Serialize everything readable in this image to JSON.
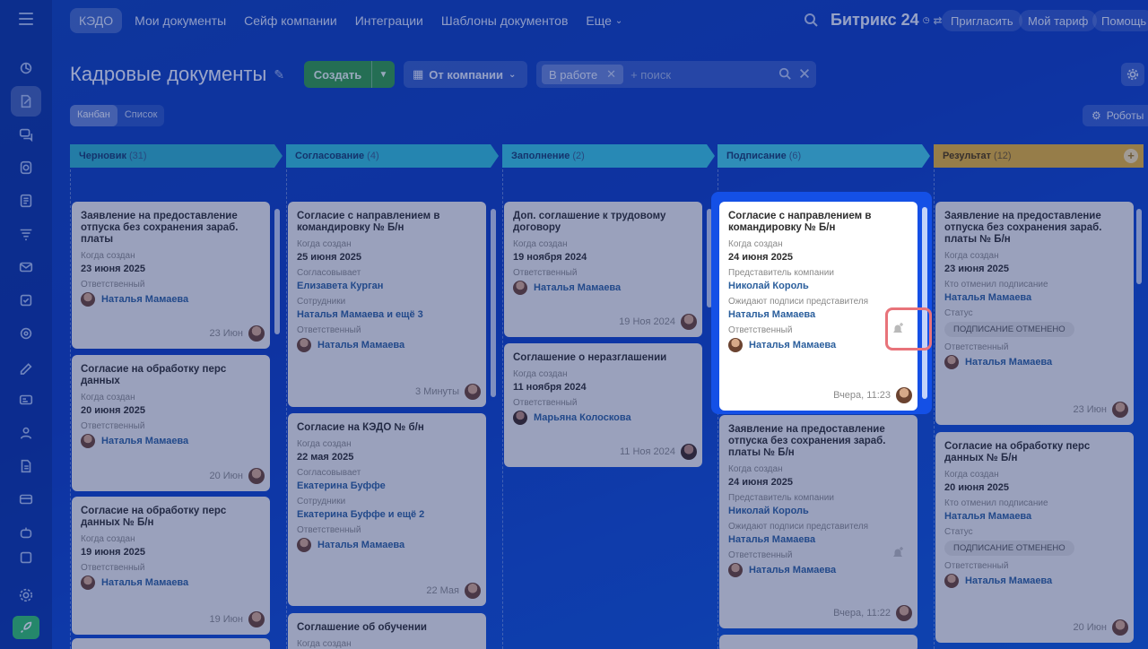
{
  "topnav": {
    "active_tab": "КЭДО",
    "items": [
      "Мои документы",
      "Сейф компании",
      "Интеграции",
      "Шаблоны документов"
    ],
    "more": "Еще",
    "brand": "Битрикс 24",
    "invite": "Пригласить",
    "tariff": "Мой тариф",
    "help": "Помощь"
  },
  "header": {
    "title": "Кадровые документы",
    "create": "Создать",
    "from_company": "От компании",
    "filter_chip": "В работе",
    "search_placeholder": "+ поиск"
  },
  "view": {
    "kanban": "Канбан",
    "list": "Список",
    "robots": "Роботы"
  },
  "columns": [
    {
      "title": "Черновик",
      "count": "(31)",
      "color": "#2cb0c8"
    },
    {
      "title": "Согласование",
      "count": "(4)",
      "color": "#2fbfd8"
    },
    {
      "title": "Заполнение",
      "count": "(2)",
      "color": "#35c6e0"
    },
    {
      "title": "Подписание",
      "count": "(6)",
      "color": "#3fcce6"
    },
    {
      "title": "Результат",
      "count": "(12)",
      "color": "#e6b233"
    }
  ],
  "labels": {
    "created": "Когда создан",
    "responsible": "Ответственный",
    "approver": "Согласовывает",
    "employees": "Сотрудники",
    "company_rep": "Представитель компании",
    "await_sign": "Ожидают подписи представителя",
    "cancelled_by": "Кто отменил подписание",
    "status": "Статус"
  },
  "cards": {
    "c1_1": {
      "title": "Заявление на предоставление отпуска без сохранения зараб. платы",
      "date": "23 июня 2025",
      "resp": "Наталья Мамаева",
      "foot": "23 Июн"
    },
    "c1_2": {
      "title": "Согласие на обработку перс данных",
      "date": "20 июня 2025",
      "resp": "Наталья Мамаева",
      "foot": "20 Июн"
    },
    "c1_3": {
      "title": "Согласие на обработку перс данных № Б/н",
      "date": "19 июня 2025",
      "resp": "Наталья Мамаева",
      "foot": "19 Июн"
    },
    "c2_1": {
      "title": "Согласие с направлением в командировку № Б/н",
      "date": "25 июня 2025",
      "approver": "Елизавета Курган",
      "employees": "Наталья Мамаева и ещё 3",
      "resp": "Наталья Мамаева",
      "foot": "3 Минуты"
    },
    "c2_2": {
      "title": "Согласие на КЭДО № б/н",
      "date": "22 мая 2025",
      "approver": "Екатерина Буффе",
      "employees": "Екатерина Буффе и ещё 2",
      "resp": "Наталья Мамаева",
      "foot": "22 Мая"
    },
    "c2_3": {
      "title": "Соглашение об обучении"
    },
    "c3_1": {
      "title": "Доп. соглашение к трудовому договору",
      "date": "19 ноября 2024",
      "resp": "Наталья Мамаева",
      "foot": "19 Ноя 2024"
    },
    "c3_2": {
      "title": "Соглашение о неразглашении",
      "date": "11 ноября 2024",
      "resp": "Марьяна Колоскова",
      "foot": "11 Ноя 2024"
    },
    "c4_1": {
      "title": "Согласие с направлением в командировку № Б/н",
      "date": "24 июня 2025",
      "rep": "Николай Король",
      "await": "Наталья Мамаева",
      "resp": "Наталья Мамаева",
      "foot": "Вчера, 11:23"
    },
    "c4_2": {
      "title": "Заявление на предоставление отпуска без сохранения зараб. платы № Б/н",
      "date": "24 июня 2025",
      "rep": "Николай Король",
      "await": "Наталья Мамаева",
      "resp": "Наталья Мамаева",
      "foot": "Вчера, 11:22"
    },
    "c5_1": {
      "title": "Заявление на предоставление отпуска без сохранения зараб. платы № Б/н",
      "date": "23 июня 2025",
      "cancelled": "Наталья Мамаева",
      "status": "ПОДПИСАНИЕ ОТМЕНЕНО",
      "resp": "Наталья Мамаева",
      "foot": "23 Июн"
    },
    "c5_2": {
      "title": "Согласие на обработку перс данных № Б/н",
      "date": "20 июня 2025",
      "cancelled": "Наталья Мамаева",
      "status": "ПОДПИСАНИЕ ОТМЕНЕНО",
      "resp": "Наталья Мамаева",
      "foot": "20 Июн"
    }
  }
}
